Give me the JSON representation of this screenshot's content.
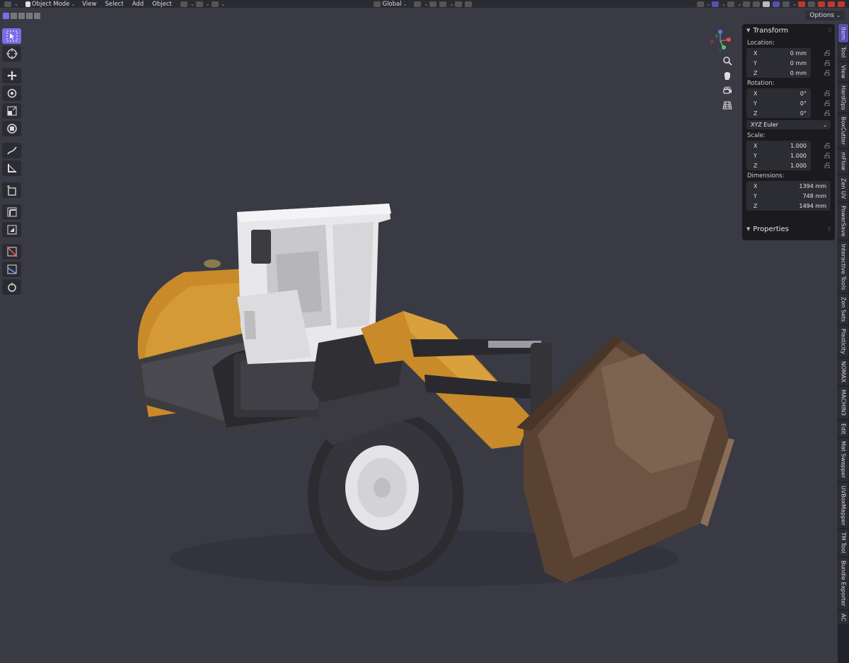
{
  "header": {
    "mode": "Object Mode",
    "menus": [
      "View",
      "Select",
      "Add",
      "Object"
    ],
    "orientation": "Global"
  },
  "toolbar_row": {
    "options_label": "Options"
  },
  "tools": [
    "select-box",
    "cursor",
    "move",
    "rotate",
    "scale",
    "transform",
    "annotate",
    "measure",
    "add-cube",
    "extrude",
    "inset",
    "cut",
    "knife",
    "spin"
  ],
  "transform": {
    "title": "Transform",
    "location_label": "Location:",
    "location": [
      {
        "axis": "X",
        "value": "0 mm"
      },
      {
        "axis": "Y",
        "value": "0 mm"
      },
      {
        "axis": "Z",
        "value": "0 mm"
      }
    ],
    "rotation_label": "Rotation:",
    "rotation": [
      {
        "axis": "X",
        "value": "0°"
      },
      {
        "axis": "Y",
        "value": "0°"
      },
      {
        "axis": "Z",
        "value": "0°"
      }
    ],
    "rotation_mode": "XYZ Euler",
    "scale_label": "Scale:",
    "scale": [
      {
        "axis": "X",
        "value": "1.000"
      },
      {
        "axis": "Y",
        "value": "1.000"
      },
      {
        "axis": "Z",
        "value": "1.000"
      }
    ],
    "dimensions_label": "Dimensions:",
    "dimensions": [
      {
        "axis": "X",
        "value": "1394 mm"
      },
      {
        "axis": "Y",
        "value": "748 mm"
      },
      {
        "axis": "Z",
        "value": "1494 mm"
      }
    ]
  },
  "properties": {
    "title": "Properties"
  },
  "side_tabs": [
    "Item",
    "Tool",
    "View",
    "HardOps",
    "BoxCutter",
    "mFlow",
    "Zen UV",
    "PowerSave",
    "Interactive Tools",
    "Zen Sets",
    "Plasticity",
    "NOMAX",
    "MACHIN3",
    "Edit",
    "Mat Swapper",
    "UVBoxMapper",
    "TM Tool",
    "Bundle Exporter",
    "AC"
  ],
  "colors": {
    "accent": "#7c6ee6",
    "background": "#3a3a45",
    "panel": "#1a1a1f"
  }
}
